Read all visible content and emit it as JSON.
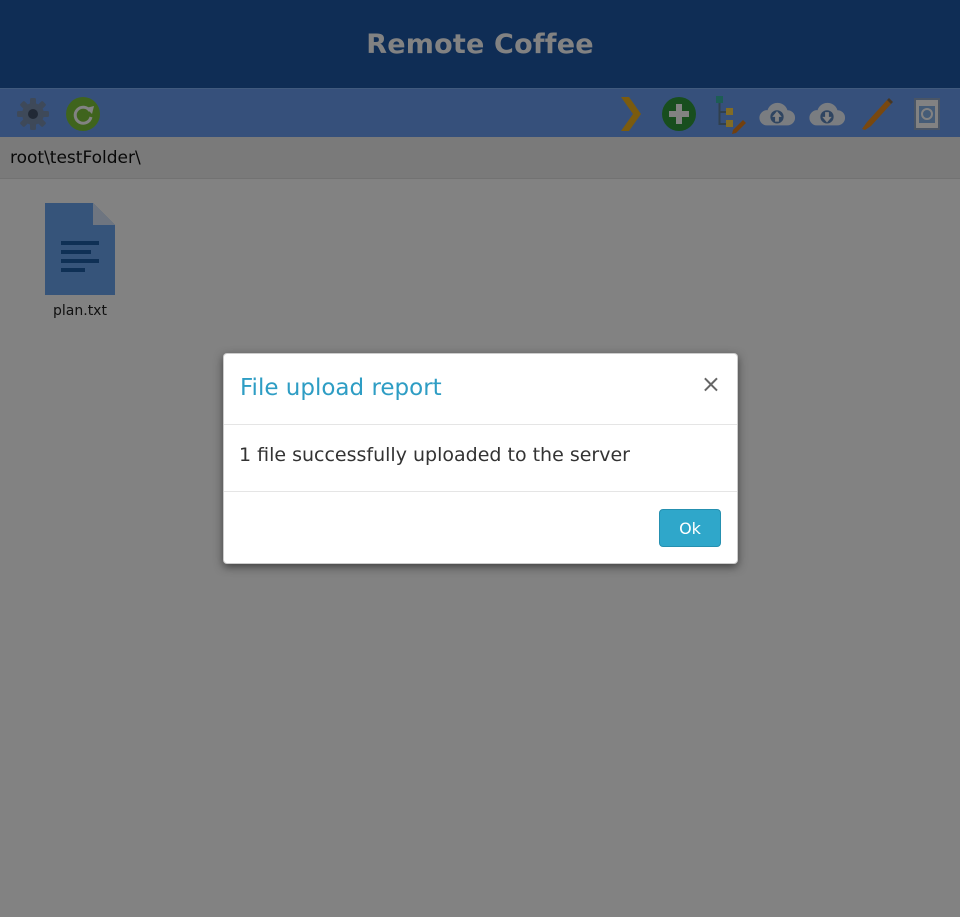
{
  "app": {
    "title": "Remote Coffee"
  },
  "toolbar": {
    "left_icons": [
      "settings-gear-icon",
      "refresh-icon"
    ],
    "right_icons": [
      "chevron-right-icon",
      "add-icon",
      "folder-tree-edit-icon",
      "cloud-upload-icon",
      "cloud-download-icon",
      "pencil-rename-icon",
      "recycle-bin-icon"
    ]
  },
  "path": {
    "text": "root\\testFolder\\"
  },
  "files": [
    {
      "name": "plan.txt",
      "icon": "text-file-icon"
    }
  ],
  "dialog": {
    "title": "File upload report",
    "close_label": "×",
    "message": "1 file successfully uploaded to the server",
    "ok_label": "Ok"
  },
  "colors": {
    "header_bg": "#1f58a8",
    "toolbar_bg": "#6a9ef2",
    "accent": "#2fa7ca",
    "dialog_title": "#2e9dc4"
  }
}
